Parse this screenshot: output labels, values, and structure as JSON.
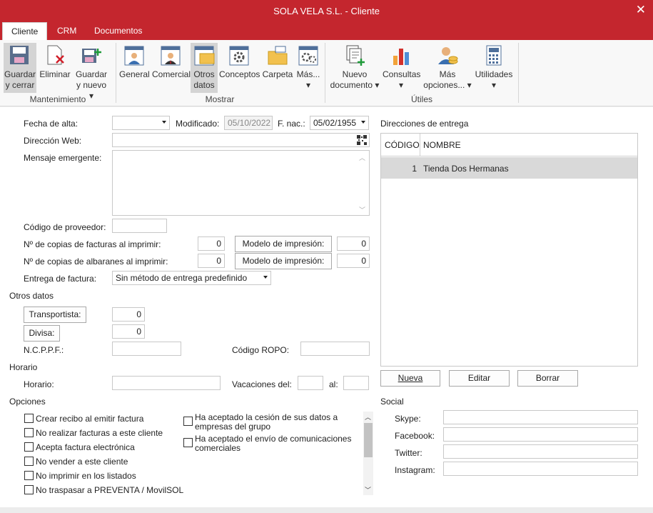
{
  "window": {
    "title": "SOLA VELA S.L. - Cliente"
  },
  "tabs": [
    "Cliente",
    "CRM",
    "Documentos"
  ],
  "ribbon": {
    "mantenimiento": {
      "label": "Mantenimiento",
      "guardar_cerrar": [
        "Guardar",
        "y cerrar"
      ],
      "eliminar": "Eliminar",
      "guardar_nuevo": [
        "Guardar",
        "y nuevo"
      ]
    },
    "mostrar": {
      "label": "Mostrar",
      "general": "General",
      "comercial": "Comercial",
      "otros_datos": [
        "Otros",
        "datos"
      ],
      "conceptos": "Conceptos",
      "carpeta": "Carpeta",
      "mas": "Más..."
    },
    "utiles": {
      "label": "Útiles",
      "nuevo_documento": [
        "Nuevo",
        "documento"
      ],
      "consultas": "Consultas",
      "mas_opciones": [
        "Más",
        "opciones..."
      ],
      "utilidades": "Utilidades"
    }
  },
  "form": {
    "fecha_alta_label": "Fecha de alta:",
    "fecha_alta_value": "",
    "modificado_label": "Modificado:",
    "modificado_value": "05/10/2022",
    "fnac_label": "F. nac.:",
    "fnac_value": "05/02/1955",
    "web_label": "Dirección Web:",
    "web_value": "",
    "mensaje_label": "Mensaje emergente:",
    "codigo_prov_label": "Código de proveedor:",
    "copias_fact_label": "Nº de copias de facturas al imprimir:",
    "copias_fact_value": "0",
    "modelo_label": "Modelo de impresión:",
    "modelo_fact_value": "0",
    "copias_alb_label": "Nº de copias de albaranes al imprimir:",
    "copias_alb_value": "0",
    "modelo_alb_value": "0",
    "entrega_label": "Entrega de factura:",
    "entrega_value": "Sin método de entrega predefinido"
  },
  "otros_datos": {
    "title": "Otros datos",
    "transportista_label": "Transportista:",
    "transportista_value": "0",
    "divisa_label": "Divisa:",
    "divisa_value": "0",
    "ncppf_label": "N.C.P.P.F.:",
    "ropo_label": "Código ROPO:"
  },
  "horario": {
    "title": "Horario",
    "horario_label": "Horario:",
    "vacaciones_label": "Vacaciones del:",
    "al_label": "al:"
  },
  "opciones": {
    "title": "Opciones",
    "left": [
      "Crear recibo al emitir factura",
      "No realizar facturas a este cliente",
      "Acepta factura electrónica",
      "No vender a este cliente",
      "No imprimir en los listados",
      "No traspasar a PREVENTA / MovilSOL"
    ],
    "right": [
      [
        "Ha aceptado la cesión de sus datos a",
        "empresas del grupo"
      ],
      [
        "Ha aceptado el envío de comunicaciones",
        "comerciales"
      ]
    ]
  },
  "direcciones": {
    "title": "Direcciones de entrega",
    "columns": [
      "CÓDIGO",
      "NOMBRE"
    ],
    "rows": [
      {
        "codigo": "1",
        "nombre": "Tienda Dos Hermanas"
      }
    ],
    "nueva": "Nueva",
    "editar": "Editar",
    "borrar": "Borrar"
  },
  "social": {
    "title": "Social",
    "skype": "Skype:",
    "facebook": "Facebook:",
    "twitter": "Twitter:",
    "instagram": "Instagram:"
  },
  "colors": {
    "accent": "#c4262e",
    "selected_row": "#d9d9d9"
  }
}
